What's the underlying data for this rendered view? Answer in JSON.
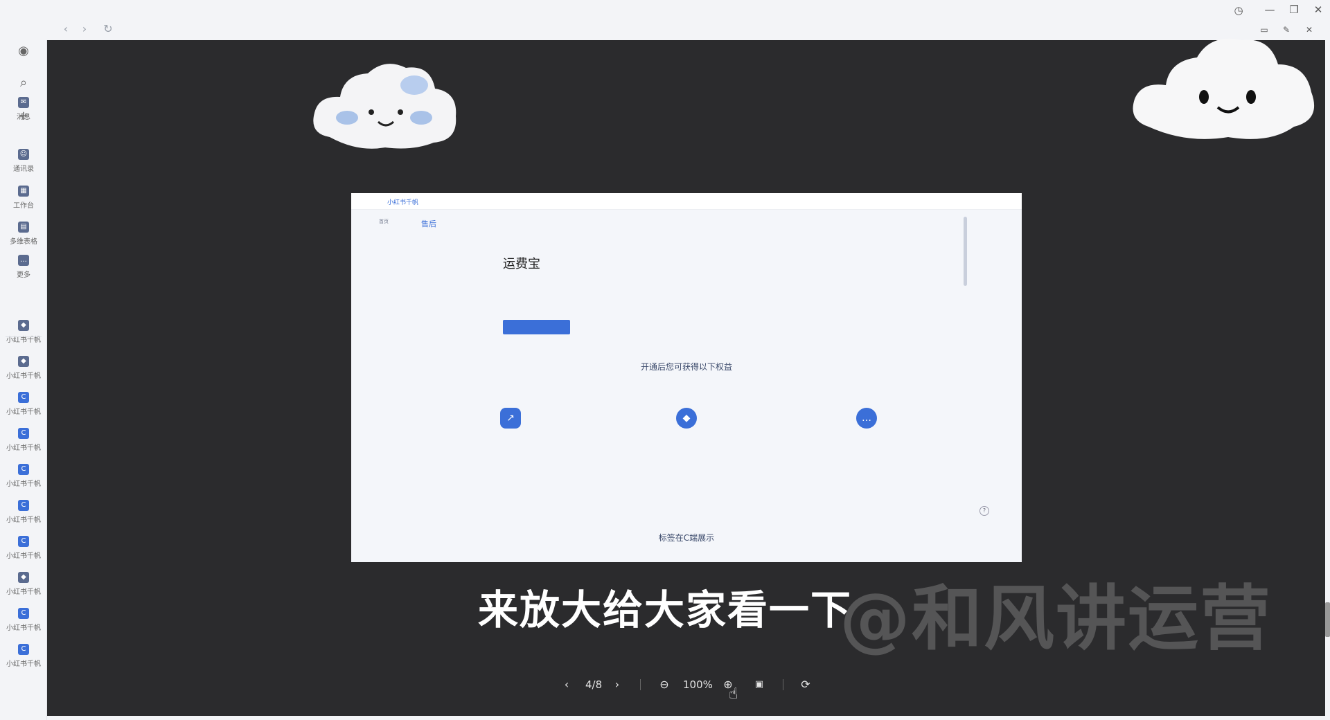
{
  "window": {
    "nav": {
      "back_icon": "chevron-left-icon",
      "forward_icon": "chevron-right-icon",
      "refresh_icon": "refresh-icon"
    },
    "controls": {
      "history_icon": "history-icon",
      "minimize_icon": "minimize-icon",
      "restore_icon": "restore-icon",
      "close_icon": "close-icon",
      "window_icon": "window-icon",
      "pin_icon": "pin-icon"
    }
  },
  "sidebar": {
    "top_icons": [
      "avatar-icon",
      "search-icon",
      "plus-icon"
    ],
    "items": [
      {
        "label": "消息",
        "badge": "",
        "glyph": "✉"
      },
      {
        "label": "通讯录",
        "glyph": "☺"
      },
      {
        "label": "工作台",
        "glyph": "▦"
      },
      {
        "label": "多维表格",
        "glyph": "▤"
      },
      {
        "label": "更多",
        "badge": "",
        "glyph": "…"
      },
      {
        "label": "小红书千帆",
        "glyph": "◆"
      },
      {
        "label": "小红书千帆",
        "glyph": "◆"
      },
      {
        "label": "小红书千帆",
        "glyph": "C"
      },
      {
        "label": "小红书千帆",
        "glyph": "C"
      },
      {
        "label": "小红书千帆",
        "glyph": "C"
      },
      {
        "label": "小红书千帆",
        "glyph": "C"
      },
      {
        "label": "小红书千帆",
        "glyph": "C"
      },
      {
        "label": "小红书千帆",
        "glyph": "◆"
      },
      {
        "label": "小红书千帆",
        "glyph": "C"
      },
      {
        "label": "小红书千帆",
        "glyph": "C"
      }
    ]
  },
  "screenshot": {
    "brand": "小红书千帆",
    "top_note": "",
    "top_links": [
      "",
      "",
      "",
      "",
      ""
    ],
    "side_primary": [
      "首页",
      "",
      "",
      "",
      "",
      "",
      "",
      "",
      "",
      "",
      "",
      "",
      "",
      "",
      ""
    ],
    "side_secondary_head": "售后",
    "side_secondary": [
      "",
      "",
      "",
      "",
      "",
      "",
      "",
      "",
      "",
      "",
      "",
      "",
      "",
      ""
    ],
    "title": "运费宝",
    "description": "",
    "sub_note": "",
    "primary_button": "",
    "link_text": "",
    "section_benefits": "开通后您可获得以下权益",
    "benefits": [
      {
        "name": "",
        "text1": "",
        "text2": "",
        "icon": "trend-chart-icon"
      },
      {
        "name": "",
        "text1": "",
        "text2": "",
        "icon": "water-drop-icon"
      },
      {
        "name": "",
        "text1": "",
        "text2": "",
        "icon": "chat-bubble-icon"
      }
    ],
    "section_display": "标签在C端展示"
  },
  "overlay": {
    "subtitle": "来放大给大家看一下",
    "watermark": "@和风讲运营"
  },
  "viewer_toolbar": {
    "prev_icon": "chevron-left-icon",
    "page": "4/8",
    "next_icon": "chevron-right-icon",
    "zoom_out_icon": "zoom-out-icon",
    "zoom": "100%",
    "zoom_in_icon": "zoom-in-icon",
    "actual_size_icon": "actual-size-icon",
    "rotate_icon": "rotate-icon"
  },
  "colors": {
    "viewer_bg": "#2b2b2d",
    "accent": "#3b6fd8"
  }
}
